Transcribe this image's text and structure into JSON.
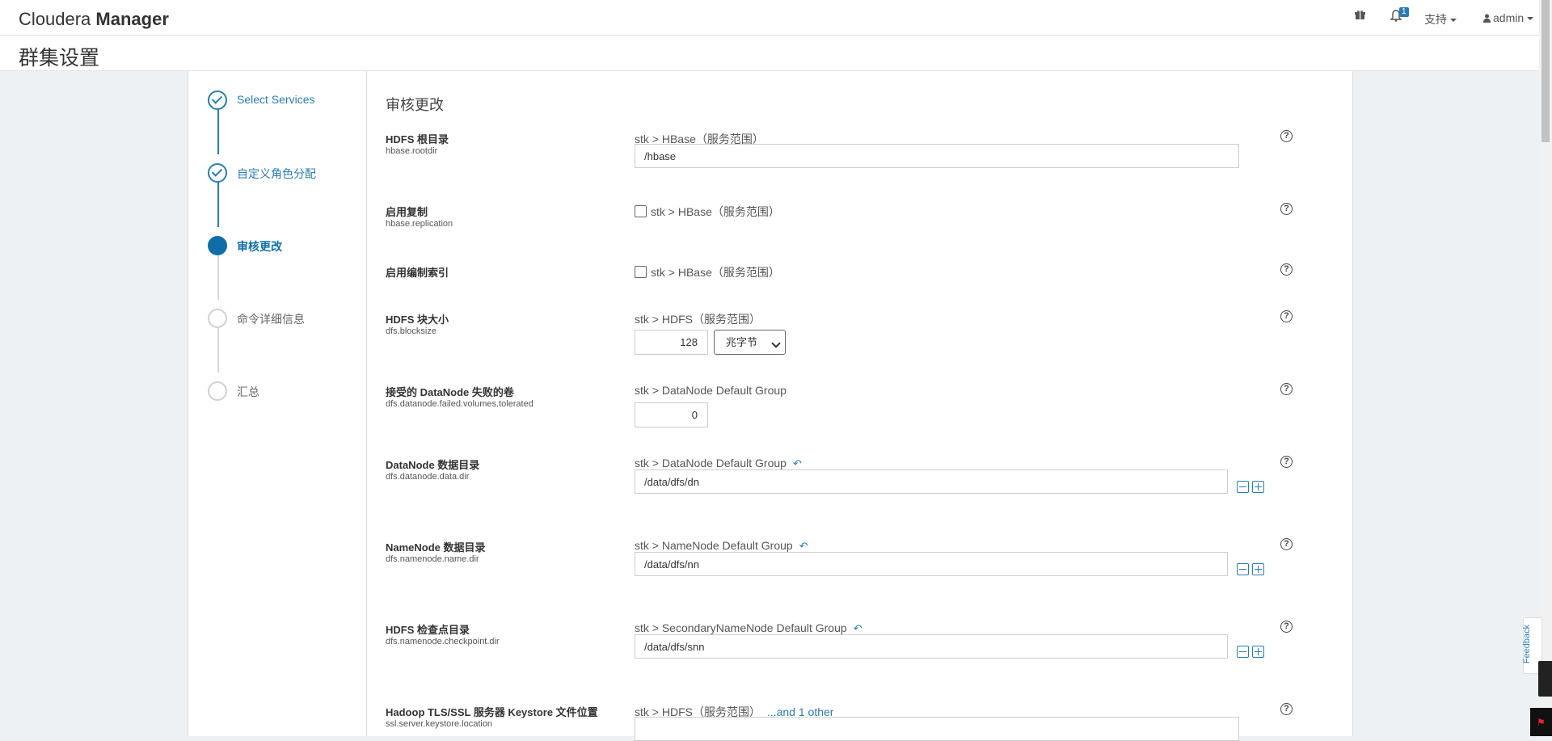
{
  "app": {
    "brand_light": "Cloudera",
    "brand_bold": "Manager",
    "notifications_count": "1",
    "support_label": "支持",
    "user_label": "admin",
    "page_title": "群集设置"
  },
  "wizard": {
    "steps": [
      {
        "label": "Select Services",
        "state": "done"
      },
      {
        "label": "自定义角色分配",
        "state": "done"
      },
      {
        "label": "审核更改",
        "state": "active"
      },
      {
        "label": "命令详细信息",
        "state": "pending"
      },
      {
        "label": "汇总",
        "state": "pending"
      }
    ]
  },
  "review": {
    "section_title": "审核更改",
    "rows": [
      {
        "label": "HDFS 根目录",
        "key": "hbase.rootdir",
        "scope": "stk > HBase（服务范围）",
        "value": "/hbase"
      },
      {
        "label": "启用复制",
        "key": "hbase.replication",
        "scope": "stk > HBase（服务范围）",
        "checked": false
      },
      {
        "label": "启用编制索引",
        "key": "",
        "scope": "stk > HBase（服务范围）",
        "checked": false
      },
      {
        "label": "HDFS 块大小",
        "key": "dfs.blocksize",
        "scope": "stk > HDFS（服务范围）",
        "value": "128",
        "unit": "兆字节"
      },
      {
        "label": "接受的 DataNode 失败的卷",
        "key": "dfs.datanode.failed.volumes.tolerated",
        "scope": "stk > DataNode Default Group",
        "value": "0"
      },
      {
        "label": "DataNode 数据目录",
        "key": "dfs.datanode.data.dir",
        "scope": "stk > DataNode Default Group",
        "value": "/data/dfs/dn"
      },
      {
        "label": "NameNode 数据目录",
        "key": "dfs.namenode.name.dir",
        "scope": "stk > NameNode Default Group",
        "value": "/data/dfs/nn"
      },
      {
        "label": "HDFS 检查点目录",
        "key": "dfs.namenode.checkpoint.dir",
        "scope": "stk > SecondaryNameNode Default Group",
        "value": "/data/dfs/snn"
      },
      {
        "label": "Hadoop TLS/SSL 服务器 Keystore 文件位置",
        "key": "ssl.server.keystore.location",
        "scope": "stk > HDFS（服务范围）",
        "scope_link": "...and 1 other",
        "value": ""
      }
    ]
  },
  "misc": {
    "help_glyph": "?",
    "undo_icon": "undo-icon",
    "feedback_label": "Feedback",
    "accent_color": "#2a7cad"
  }
}
